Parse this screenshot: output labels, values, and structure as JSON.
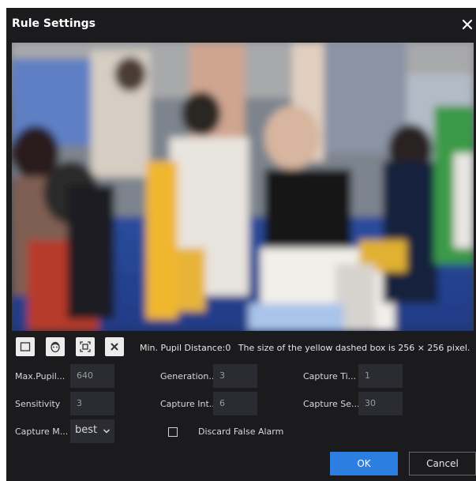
{
  "dialog": {
    "title": "Rule Settings",
    "close_icon": "close-icon"
  },
  "toolbar": {
    "buttons": [
      "draw-rectangle-icon",
      "face-icon",
      "fit-box-icon",
      "delete-icon"
    ],
    "min_pupil": "Min. Pupil Distance:0",
    "box_info": "The size of the yellow dashed box is 256 × 256 pixel."
  },
  "fields": {
    "max_pupil": {
      "label": "Max.Pupil...",
      "value": "640"
    },
    "generation": {
      "label": "Generation...",
      "value": "3"
    },
    "capture_ti": {
      "label": "Capture Ti...",
      "value": "1"
    },
    "sensitivity": {
      "label": "Sensitivity",
      "value": "3"
    },
    "capture_int": {
      "label": "Capture Int...",
      "value": "6"
    },
    "capture_se": {
      "label": "Capture Se...",
      "value": "30"
    },
    "capture_m": {
      "label": "Capture M...",
      "value": "best"
    },
    "discard": {
      "label": "Discard False Alarm",
      "checked": false
    }
  },
  "actions": {
    "ok": "OK",
    "cancel": "Cancel"
  },
  "colors": {
    "background": "#1b1b1e",
    "input": "#2b2c31",
    "accent": "#2c7ee0"
  }
}
